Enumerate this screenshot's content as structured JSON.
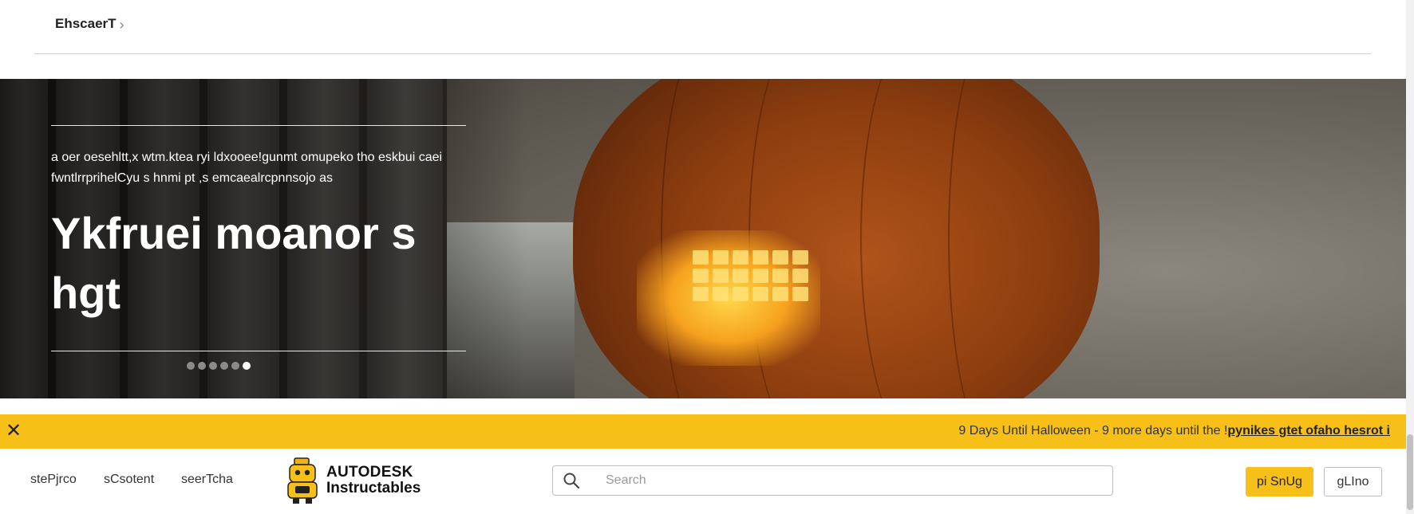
{
  "breadcrumb": {
    "label": "EhscaerT",
    "chevron": "chevron-right-icon"
  },
  "hero": {
    "description": "a oer oesehltt,x wtm.ktea ryi ldxooee!gunmt omupeko tho eskbui caei fwntlrrprihelCyu s hnmi pt ,s emcaealrcpnnsojo as",
    "title": "Ykfruei moanor s hgt",
    "slides": {
      "count": 6,
      "active": 6
    }
  },
  "promo": {
    "text": "9 Days Until Halloween - 9 more days until the !",
    "link": "pynikes gtet ofaho hesrot i",
    "close_icon": "close-icon",
    "color": "#f6c019"
  },
  "nav": {
    "links": [
      "stePjrco",
      "sCsotent",
      "seerTcha"
    ],
    "logo": {
      "brand": "AUTODESK",
      "product": "Instructables",
      "icon": "robot-logo-icon"
    },
    "search": {
      "placeholder": "Search",
      "icon": "search-icon"
    },
    "signup_label": "pi SnUg",
    "login_label": "gLIno"
  },
  "colors": {
    "accent": "#f6c019",
    "text": "#222222"
  }
}
